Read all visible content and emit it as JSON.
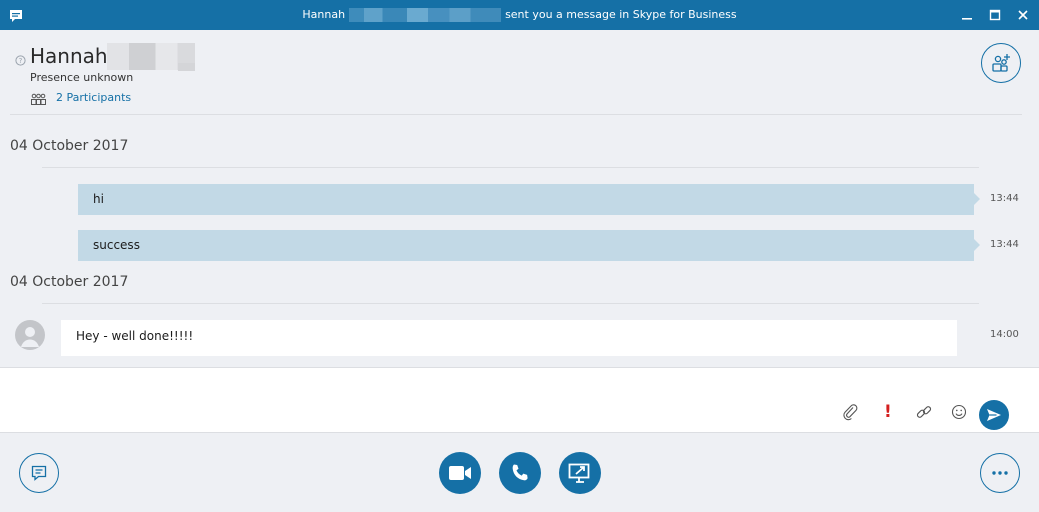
{
  "window": {
    "title_prefix": "Hannah",
    "title_suffix": "sent you a message in Skype for Business",
    "accent_color": "#1570a6"
  },
  "header": {
    "contact_name": "Hannah",
    "presence": "Presence unknown",
    "participants": "2 Participants"
  },
  "conversation": {
    "groups": [
      {
        "date": "04 October 2017",
        "messages": [
          {
            "text": "hi",
            "time": "13:44",
            "direction": "outgoing"
          },
          {
            "text": "success",
            "time": "13:44",
            "direction": "outgoing"
          }
        ]
      },
      {
        "date": "04 October 2017",
        "messages": [
          {
            "text": "Hey - well done!!!!!",
            "time": "14:00",
            "direction": "incoming"
          }
        ]
      }
    ]
  },
  "compose": {
    "value": "",
    "important_mark": "!"
  },
  "icons": {
    "app": "chat-app-icon",
    "minimize": "minimize-icon",
    "maximize": "maximize-icon",
    "close": "close-icon",
    "presence": "presence-unknown-icon",
    "participants": "participants-icon",
    "add_person": "add-participant-icon",
    "attach": "paperclip-icon",
    "important": "exclamation-icon",
    "link": "link-icon",
    "emoticon": "smiley-icon",
    "send": "send-icon",
    "im": "chat-bubble-icon",
    "video": "video-camera-icon",
    "call": "phone-icon",
    "share": "present-screen-icon",
    "more": "more-options-icon"
  }
}
